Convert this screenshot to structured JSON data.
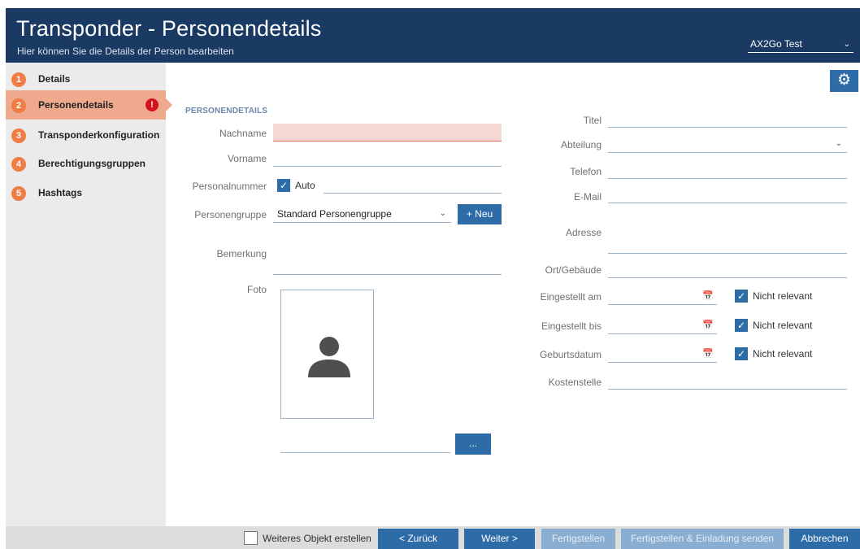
{
  "header": {
    "title": "Transponder - Personendetails",
    "subtitle": "Hier können Sie die Details der Person bearbeiten",
    "project": "AX2Go Test"
  },
  "sidebar": {
    "items": [
      {
        "num": "1",
        "label": "Details"
      },
      {
        "num": "2",
        "label": "Personendetails",
        "active": true,
        "error": "!"
      },
      {
        "num": "3",
        "label": "Transponderkonfiguration"
      },
      {
        "num": "4",
        "label": "Berechtigungsgruppen"
      },
      {
        "num": "5",
        "label": "Hashtags"
      }
    ]
  },
  "form": {
    "section": "PERSONENDETAILS",
    "nachname": {
      "label": "Nachname",
      "value": ""
    },
    "vorname": {
      "label": "Vorname",
      "value": ""
    },
    "personalnummer": {
      "label": "Personalnummer",
      "auto_label": "Auto",
      "auto_checked": true,
      "value": ""
    },
    "personengruppe": {
      "label": "Personengruppe",
      "value": "Standard Personengruppe",
      "new_button": "+ Neu"
    },
    "bemerkung": {
      "label": "Bemerkung",
      "value": ""
    },
    "foto": {
      "label": "Foto",
      "path": "",
      "browse_button": "..."
    },
    "titel": {
      "label": "Titel",
      "value": ""
    },
    "abteilung": {
      "label": "Abteilung",
      "value": ""
    },
    "telefon": {
      "label": "Telefon",
      "value": ""
    },
    "email": {
      "label": "E-Mail",
      "value": ""
    },
    "adresse": {
      "label": "Adresse",
      "value": ""
    },
    "ort": {
      "label": "Ort/Gebäude",
      "value": ""
    },
    "eingestellt_am": {
      "label": "Eingestellt am",
      "value": "",
      "nr_label": "Nicht relevant",
      "nr_checked": true
    },
    "eingestellt_bis": {
      "label": "Eingestellt bis",
      "value": "",
      "nr_label": "Nicht relevant",
      "nr_checked": true
    },
    "geburtsdatum": {
      "label": "Geburtsdatum",
      "value": "",
      "nr_label": "Nicht relevant",
      "nr_checked": true
    },
    "kostenstelle": {
      "label": "Kostenstelle",
      "value": ""
    }
  },
  "footer": {
    "weiteres_label": "Weiteres Objekt erstellen",
    "weiteres_checked": false,
    "back": "< Zurück",
    "next": "Weiter >",
    "finish": "Fertigstellen",
    "finish_invite": "Fertigstellen & Einladung senden",
    "cancel": "Abbrechen"
  },
  "colors": {
    "header_bg": "#1b3a63",
    "accent": "#2e6ca8",
    "step_badge": "#ef7d45",
    "active_item": "#efaa8d",
    "error": "#d4131f"
  }
}
